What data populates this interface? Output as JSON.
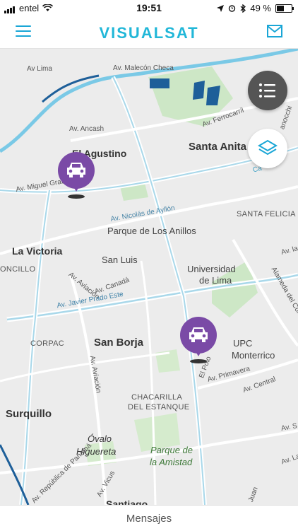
{
  "status_bar": {
    "carrier": "entel",
    "time": "19:51",
    "battery": "49 %",
    "battery_level": 0.49
  },
  "app": {
    "logo": "VISUALSAT"
  },
  "map": {
    "labels": {
      "av_lima": "Av Lima",
      "av_malecon": "Av. Malecón Checa",
      "av_ancash": "Av. Ancash",
      "el_agustino": "El Agustino",
      "santa_anita": "Santa Anita",
      "av_ferrocarril": "Av. Ferrocarril",
      "av_miguel_grau": "Av. Miguel Grau",
      "av_nicolas": "Av. Nicolás de Ayllón",
      "santa_felicia": "SANTA FELICIA",
      "parque_anillos": "Parque de Los Anillos",
      "la_victoria": "La Victoria",
      "oncillo": "ONCILLO",
      "san_luis": "San Luis",
      "av_aviacion_1": "Av. Aviación",
      "av_canada": "Av. Canadá",
      "universidad": "Universidad",
      "de_lima": "de Lima",
      "av_javier_prado": "Av. Javier Prado Este",
      "corpac": "CORPAC",
      "san_borja": "San Borja",
      "upc": "UPC",
      "monterrico": "Monterrico",
      "av_aviacion_2": "Av. Aviación",
      "el_polo": "El Polo",
      "av_primavera": "Av. Primavera",
      "av_central": "Av. Central",
      "alameda": "Alameda del Corregidor",
      "chacarilla": "CHACARILLA",
      "del_estanque": "DEL ESTANQUE",
      "surquillo": "Surquillo",
      "ovalo": "Óvalo",
      "higuereta": "Higuereta",
      "parque_amistad_1": "Parque de",
      "parque_amistad_2": "la Amistad",
      "av_republica": "Av. República de Panamá",
      "av_vicus": "Av. Vicus",
      "santiago": "Santiago",
      "carretera": "Ca",
      "juan": "Juan",
      "av_la": "Av. la",
      "av_la_2": "Av. La",
      "av_s": "Av. S",
      "anocchi": "anocchi"
    }
  },
  "bottom_bar": {
    "label": "Mensajes"
  },
  "colors": {
    "accent": "#1aa6d6",
    "pin": "#7a4aa6",
    "fab_dark": "#555555"
  }
}
